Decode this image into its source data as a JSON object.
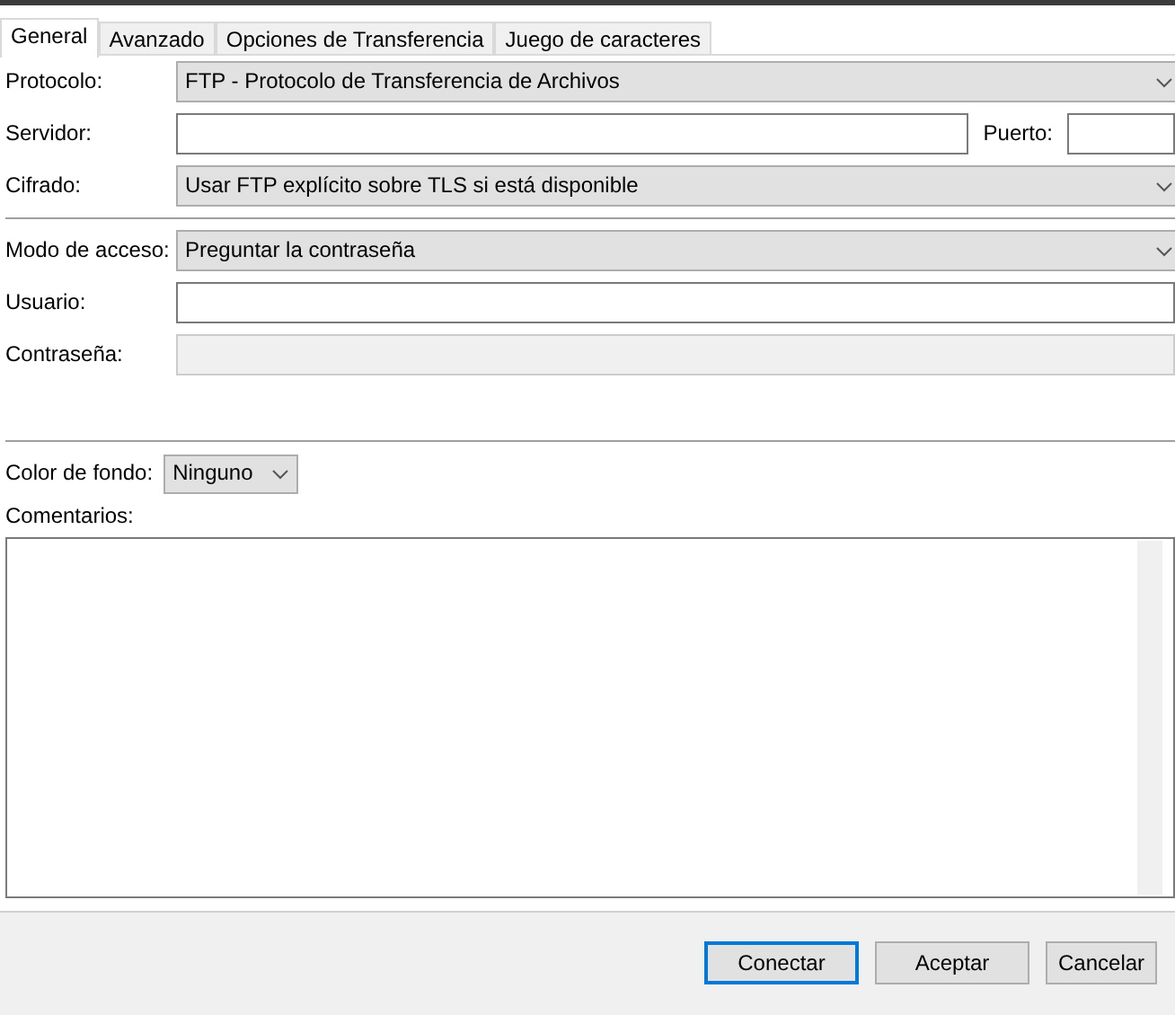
{
  "tabs": [
    {
      "label": "General",
      "selected": true
    },
    {
      "label": "Avanzado",
      "selected": false
    },
    {
      "label": "Opciones de Transferencia",
      "selected": false
    },
    {
      "label": "Juego de caracteres",
      "selected": false
    }
  ],
  "protocol": {
    "label": "Protocolo:",
    "value": "FTP - Protocolo de Transferencia de Archivos"
  },
  "server": {
    "label": "Servidor:",
    "port_label": "Puerto:"
  },
  "encryption": {
    "label": "Cifrado:",
    "value": "Usar FTP explícito sobre TLS si está disponible"
  },
  "logon_type": {
    "label": "Modo de acceso:",
    "value": "Preguntar la contraseña"
  },
  "user": {
    "label": "Usuario:"
  },
  "password": {
    "label": "Contraseña:",
    "disabled": true
  },
  "background_color": {
    "label": "Color de fondo:",
    "value": "Ninguno"
  },
  "comments": {
    "label": "Comentarios:"
  },
  "buttons": [
    {
      "label": "Conectar",
      "default": true
    },
    {
      "label": "Aceptar",
      "default": false
    },
    {
      "label": "Cancelar",
      "default": false
    }
  ]
}
